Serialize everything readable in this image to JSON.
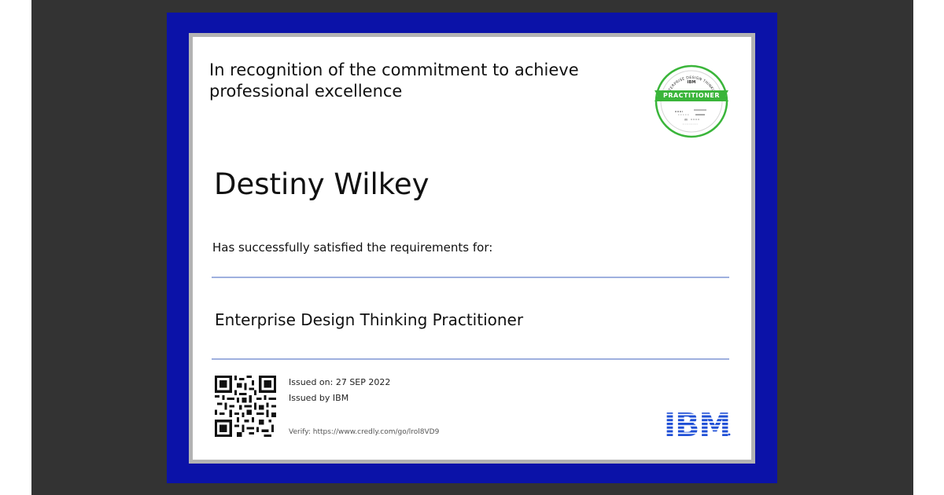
{
  "certificate": {
    "recognition_text": "In recognition of the commitment to achieve\nprofessional excellence",
    "recipient_name": "Destiny Wilkey",
    "satisfied_text": "Has successfully satisfied the requirements for:",
    "course_title": "Enterprise Design Thinking Practitioner",
    "issued_on": "Issued on: 27 SEP 2022",
    "issued_by": "Issued by IBM",
    "verify": "Verify: https://www.credly.com/go/lrol8VD9"
  },
  "badge": {
    "arc_text": "ENTERPRISE DESIGN THINKING",
    "issuer": "IBM",
    "level": "PRACTITIONER",
    "accent_color": "#3ab53a",
    "icon": "badge-icon"
  },
  "logo": {
    "text": "IBM",
    "color": "#1f4fd6",
    "icon": "ibm-logo-icon"
  },
  "qr": {
    "icon": "qr-code-icon"
  },
  "colors": {
    "frame": "#0b12a8",
    "mat": "#b3b3b3",
    "rule": "#9fb0df",
    "backdrop": "#333333"
  }
}
